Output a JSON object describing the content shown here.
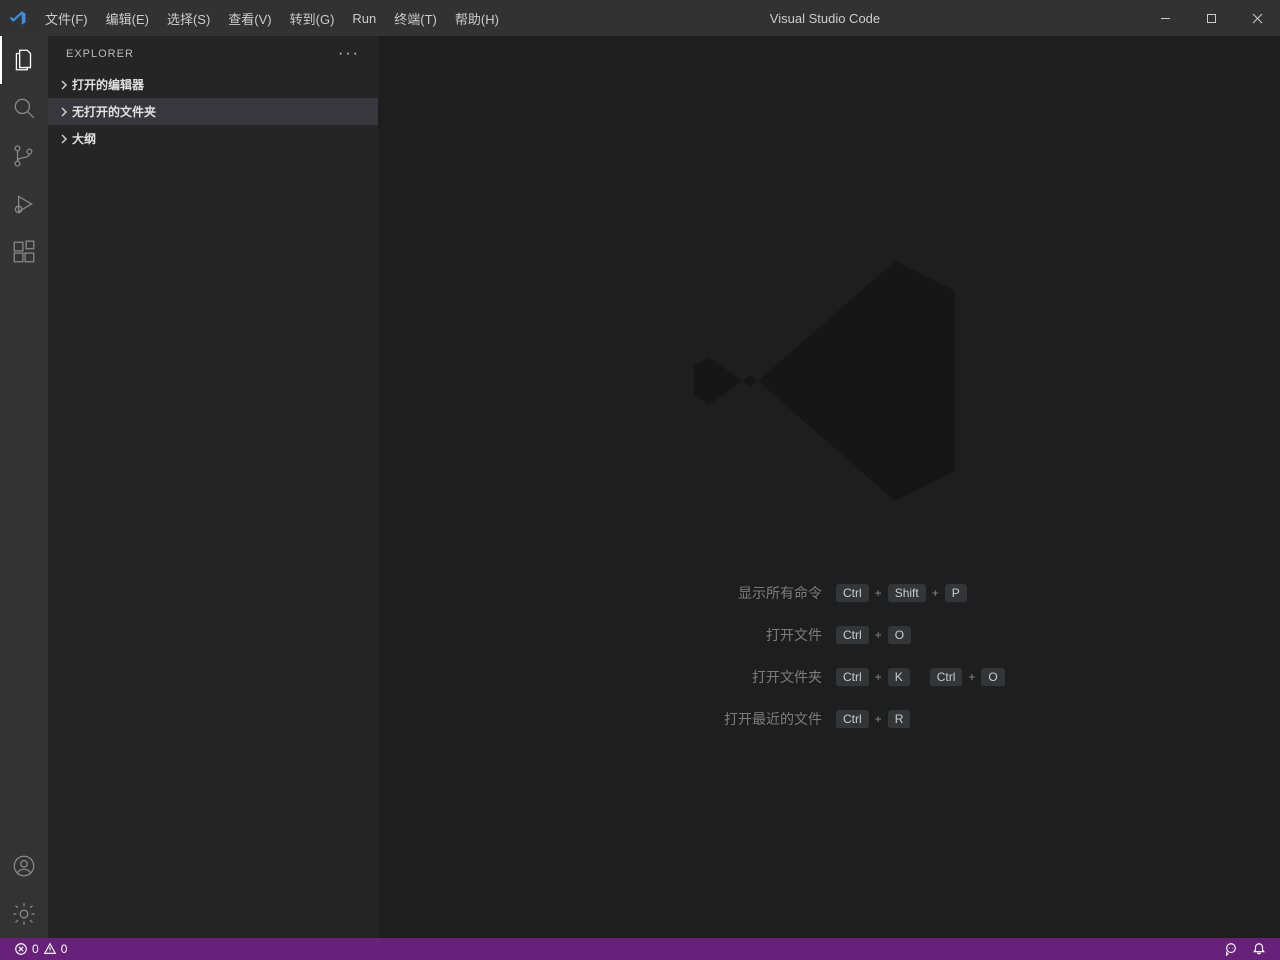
{
  "title": "Visual Studio Code",
  "menu": {
    "file": "文件(F)",
    "edit": "编辑(E)",
    "select": "选择(S)",
    "view": "查看(V)",
    "goto": "转到(G)",
    "run": "Run",
    "terminal": "终端(T)",
    "help": "帮助(H)"
  },
  "sidebar": {
    "title": "EXPLORER",
    "ellipsis": "···",
    "sections": {
      "open_editors": "打开的编辑器",
      "no_folder": "无打开的文件夹",
      "outline": "大纲"
    }
  },
  "shortcuts": {
    "show_all": {
      "label": "显示所有命令",
      "k1": "Ctrl",
      "k2": "Shift",
      "k3": "P"
    },
    "open_file": {
      "label": "打开文件",
      "k1": "Ctrl",
      "k2": "O"
    },
    "open_folder": {
      "label": "打开文件夹",
      "k1": "Ctrl",
      "k2": "K",
      "k3": "Ctrl",
      "k4": "O"
    },
    "open_recent": {
      "label": "打开最近的文件",
      "k1": "Ctrl",
      "k2": "R"
    }
  },
  "status": {
    "errors": "0",
    "warnings": "0"
  }
}
